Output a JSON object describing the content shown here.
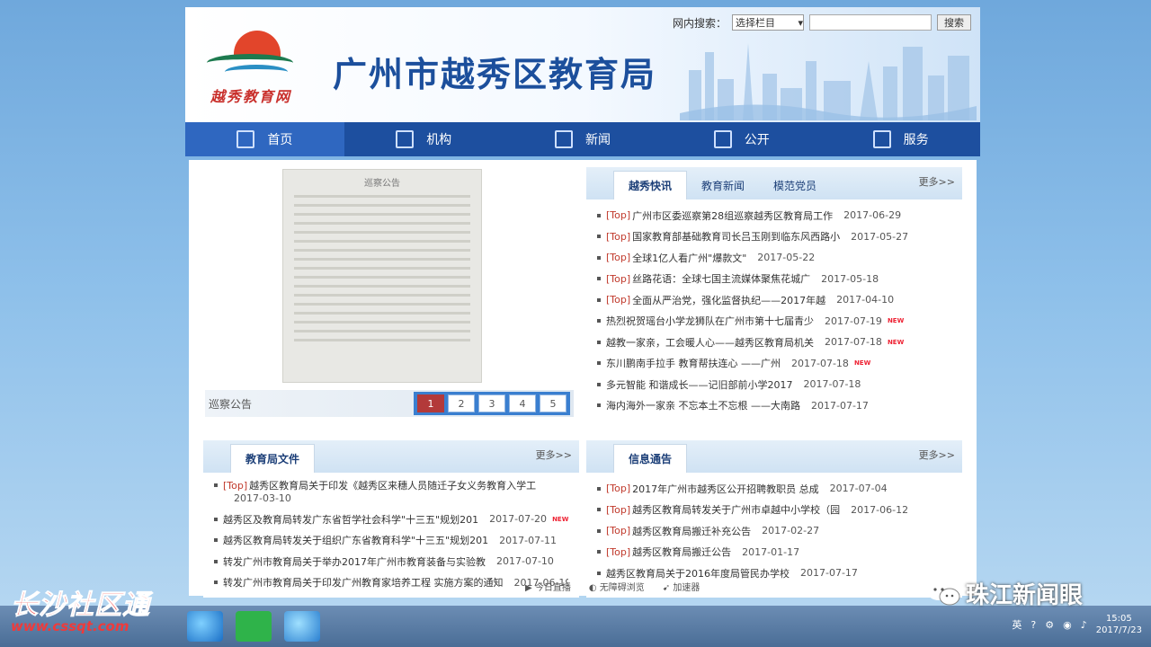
{
  "header": {
    "logo_text": "越秀教育网",
    "title": "广州市越秀区教育局",
    "search_label": "网内搜索：",
    "search_select": "选择栏目",
    "search_button": "搜索"
  },
  "nav": [
    {
      "label": "首页",
      "icon": "home-icon",
      "active": true
    },
    {
      "label": "机构",
      "icon": "org-icon",
      "active": false
    },
    {
      "label": "新闻",
      "icon": "news-icon",
      "active": false
    },
    {
      "label": "公开",
      "icon": "lock-open-icon",
      "active": false
    },
    {
      "label": "服务",
      "icon": "service-icon",
      "active": false
    }
  ],
  "slideshow": {
    "doc_title": "巡察公告",
    "caption": "巡察公告",
    "pages": [
      "1",
      "2",
      "3",
      "4",
      "5"
    ],
    "active_page": "1"
  },
  "news_box": {
    "tabs": [
      "越秀快讯",
      "教育新闻",
      "模范党员"
    ],
    "more": "更多>>",
    "items": [
      {
        "top": "[Top]",
        "title": "广州市区委巡察第28组巡察越秀区教育局工作",
        "date": "2017-06-29",
        "new": ""
      },
      {
        "top": "[Top]",
        "title": "国家教育部基础教育司长吕玉刚到临东风西路小",
        "date": "2017-05-27",
        "new": ""
      },
      {
        "top": "[Top]",
        "title": "全球1亿人看广州\"爆款文\"",
        "date": "2017-05-22",
        "new": ""
      },
      {
        "top": "[Top]",
        "title": "丝路花语：全球七国主流媒体聚焦花城广",
        "date": "2017-05-18",
        "new": ""
      },
      {
        "top": "[Top]",
        "title": "全面从严治党，强化监督执纪——2017年越",
        "date": "2017-04-10",
        "new": ""
      },
      {
        "top": "",
        "title": "热烈祝贺瑶台小学龙狮队在广州市第十七届青少",
        "date": "2017-07-19",
        "new": "NEW"
      },
      {
        "top": "",
        "title": "越教一家亲，工会暖人心——越秀区教育局机关",
        "date": "2017-07-18",
        "new": "NEW"
      },
      {
        "top": "",
        "title": "东川鹏南手拉手 教育帮扶连心 ——广州",
        "date": "2017-07-18",
        "new": "NEW"
      },
      {
        "top": "",
        "title": "多元智能 和谐成长——记旧部前小学2017",
        "date": "2017-07-18",
        "new": ""
      },
      {
        "top": "",
        "title": "海内海外一家亲 不忘本土不忘根 ——大南路",
        "date": "2017-07-17",
        "new": ""
      }
    ]
  },
  "docs_box": {
    "tab": "教育局文件",
    "more": "更多>>",
    "items": [
      {
        "top": "[Top]",
        "title": "越秀区教育局关于印发《越秀区来穗人员随迁子女义务教育入学工",
        "date": "2017-03-10",
        "new": ""
      },
      {
        "top": "",
        "title": "越秀区及教育局转发广东省哲学社会科学\"十三五\"规划201",
        "date": "2017-07-20",
        "new": "NEW"
      },
      {
        "top": "",
        "title": "越秀区教育局转发关于组织广东省教育科学\"十三五\"规划201",
        "date": "2017-07-11",
        "new": ""
      },
      {
        "top": "",
        "title": "转发广州市教育局关于举办2017年广州市教育装备与实验教",
        "date": "2017-07-10",
        "new": ""
      },
      {
        "top": "",
        "title": "转发广州市教育局关于印发广州教育家培养工程 实施方案的通知",
        "date": "2017-06-19",
        "new": ""
      }
    ]
  },
  "notice_box": {
    "tab": "信息通告",
    "more": "更多>>",
    "items": [
      {
        "top": "[Top]",
        "title": "2017年广州市越秀区公开招聘教职员 总成",
        "date": "2017-07-04"
      },
      {
        "top": "[Top]",
        "title": "越秀区教育局转发关于广州市卓越中小学校（园",
        "date": "2017-06-12"
      },
      {
        "top": "[Top]",
        "title": "越秀区教育局搬迁补充公告",
        "date": "2017-02-27"
      },
      {
        "top": "[Top]",
        "title": "越秀区教育局搬迁公告",
        "date": "2017-01-17"
      },
      {
        "top": "",
        "title": "越秀区教育局关于2016年度局管民办学校",
        "date": "2017-07-17"
      }
    ]
  },
  "site_footer": {
    "live": "今日直播",
    "accessible": "无障碍浏览",
    "speed": "加速器"
  },
  "taskbar": {
    "lang": "英",
    "time": "15:05",
    "date": "2017/7/23"
  },
  "watermarks": {
    "left_title": "长沙社区通",
    "left_url": "www.cssqt.com",
    "right_text": "珠江新闻眼"
  },
  "colors": {
    "nav_bg": "#1d4f9f",
    "title": "#1c4f9c",
    "top_tag": "#c0392b",
    "active_page": "#b33a3a"
  }
}
